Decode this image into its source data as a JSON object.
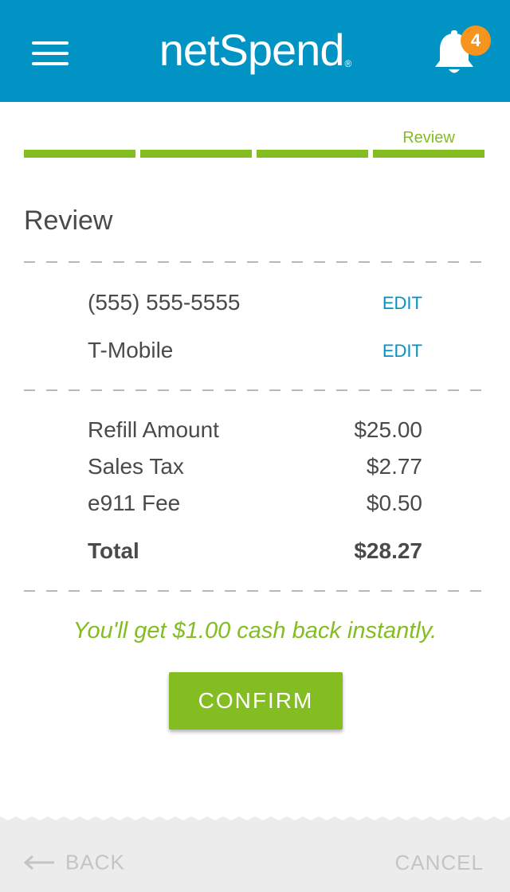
{
  "header": {
    "logo": "netSpend",
    "logo_mark": "®",
    "menu_icon": "hamburger-menu-icon",
    "bell_icon": "bell-icon",
    "notification_count": "4",
    "background_color": "#0093c4",
    "badge_color": "#f7941d"
  },
  "progress": {
    "current_step_label": "Review",
    "steps_total": 4,
    "steps_completed": 4,
    "color": "#84bd22"
  },
  "page_title": "Review",
  "details": [
    {
      "value": "(555) 555-5555",
      "action": "EDIT"
    },
    {
      "value": "T-Mobile",
      "action": "EDIT"
    }
  ],
  "summary": [
    {
      "label": "Refill Amount",
      "amount": "$25.00"
    },
    {
      "label": "Sales Tax",
      "amount": "$2.77"
    },
    {
      "label": "e911 Fee",
      "amount": "$0.50"
    }
  ],
  "total": {
    "label": "Total",
    "amount": "$28.27"
  },
  "cashback_message": "You'll get $1.00 cash back instantly.",
  "confirm_button": "CONFIRM",
  "footer": {
    "back_label": "BACK",
    "back_icon": "arrow-left-icon",
    "cancel_label": "CANCEL"
  },
  "colors": {
    "accent_green": "#84bd22",
    "link_blue": "#0093c4"
  }
}
